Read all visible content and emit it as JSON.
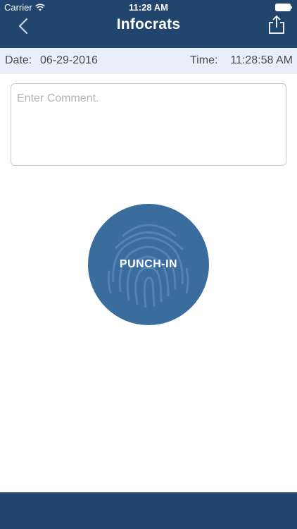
{
  "status_bar": {
    "carrier": "Carrier",
    "time": "11:28 AM"
  },
  "nav": {
    "title": "Infocrats",
    "back_icon": "chevron-left-icon",
    "share_icon": "share-icon"
  },
  "info": {
    "date_label": "Date:",
    "date_value": "06-29-2016",
    "time_label": "Time:",
    "time_value": "11:28:58 AM"
  },
  "comment": {
    "value": "",
    "placeholder": "Enter Comment."
  },
  "punch": {
    "label": "PUNCH-IN",
    "icon": "fingerprint-icon"
  },
  "colors": {
    "brand": "#22456e",
    "button": "#3b6c9e",
    "strip": "#e9eefb"
  }
}
